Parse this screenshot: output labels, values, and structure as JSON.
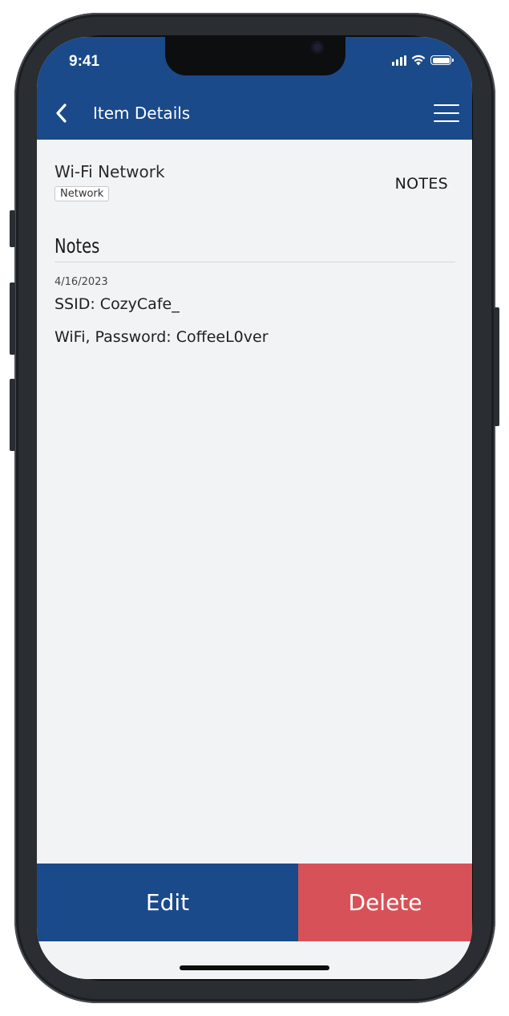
{
  "status_bar": {
    "time": "9:41"
  },
  "nav": {
    "title": "Item Details",
    "back_icon": "chevron-left-icon",
    "menu_icon": "hamburger-menu-icon"
  },
  "item": {
    "name": "Wi-Fi Network",
    "tag": "Network",
    "notes_link": "NOTES"
  },
  "notes_section": {
    "title": "Notes",
    "date": "4/16/2023",
    "line1": "SSID: CozyCafe_",
    "line2": "WiFi, Password: CoffeeL0ver"
  },
  "actions": {
    "edit_label": "Edit",
    "delete_label": "Delete"
  },
  "colors": {
    "primary": "#1a4a8a",
    "danger": "#d75258",
    "background": "#f2f3f5"
  }
}
